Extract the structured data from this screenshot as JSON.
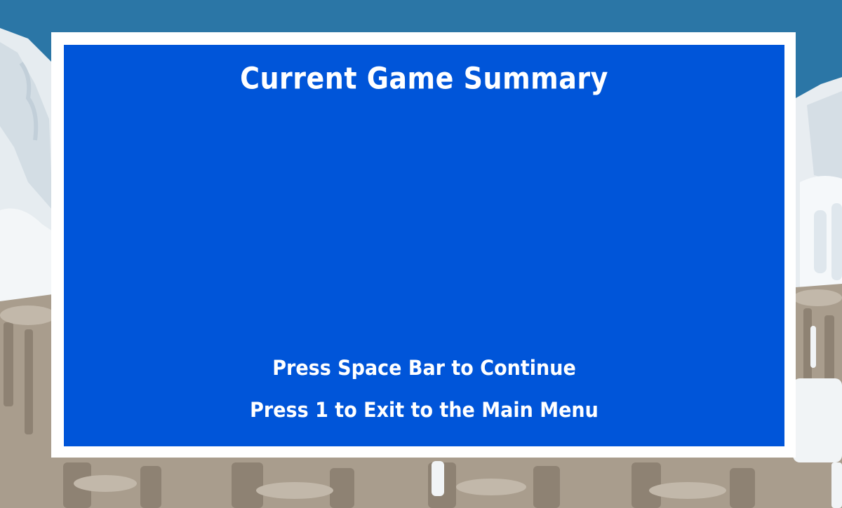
{
  "screen": {
    "title": "Current Game Summary",
    "continue_prompt": "Press Space Bar to Continue",
    "exit_prompt": "Press 1 to Exit to the Main Menu"
  },
  "colors": {
    "sky": "#2b76a6",
    "frame": "#ffffff",
    "panel": "#0055d9",
    "text": "#ffffff",
    "snow": "#e9eef2",
    "rock": "#a99d8d"
  }
}
